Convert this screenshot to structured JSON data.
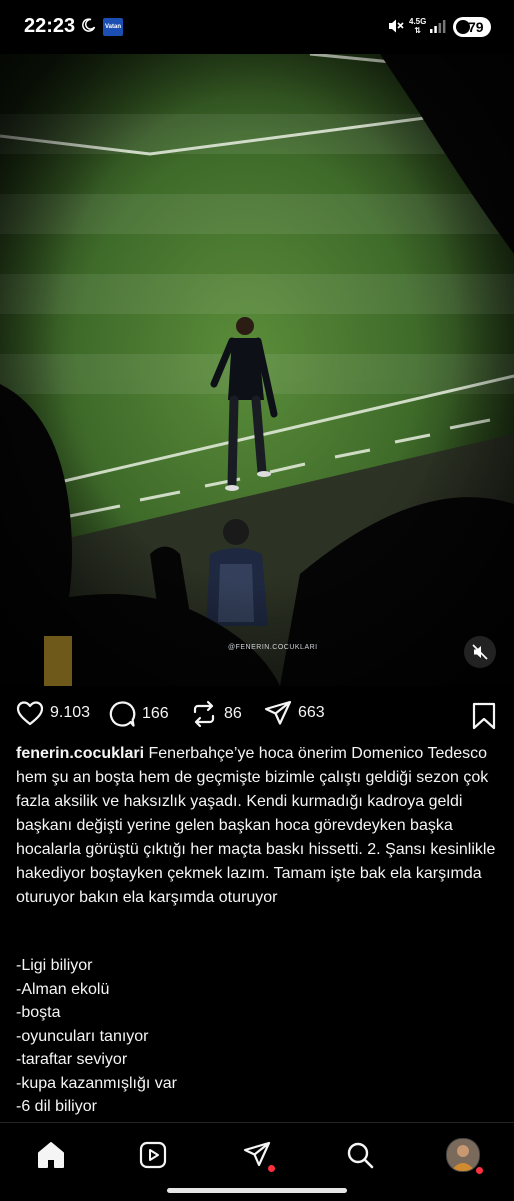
{
  "status_bar": {
    "time": "22:23",
    "network": "4.5G",
    "battery": "79"
  },
  "post": {
    "watermark": "@FENERIN.COCUKLARI",
    "likes": "9.103",
    "comments": "166",
    "reposts": "86",
    "shares": "663",
    "username": "fenerin.cocuklari",
    "caption": "Fenerbahçe’ye hoca önerim Domenico Tedesco hem şu an boşta hem de geçmişte bizimle çalıştı geldiği sezon çok fazla aksilik ve haksızlık yaşadı. Kendi kurmadığı kadroya geldi başkanı değişti yerine gelen başkan hoca görevdeyken başka hocalarla görüştü çıktığı her maçta baskı hissetti. 2. Şansı kesinlikle hakediyor boştayken çekmek lazım. Tamam işte bak ela karşımda oturuyor bakın ela karşımda oturuyor",
    "list": [
      "-Ligi biliyor",
      "-Alman ekolü",
      "-boşta",
      "-oyuncuları tanıyor",
      "-taraftar seviyor",
      "-kupa kazanmışlığı var",
      "-6 dil biliyor"
    ]
  },
  "colors": {
    "background": "#000000",
    "text": "#f5f5f5",
    "notification_dot": "#ff3040",
    "pitch": "#3f6b2a"
  },
  "icons": {
    "status": [
      "moon-icon",
      "vatan-app-icon",
      "mute-icon",
      "signal-icon",
      "battery-icon"
    ],
    "actions": [
      "heart-icon",
      "comment-icon",
      "repost-icon",
      "share-icon",
      "bookmark-icon"
    ],
    "nav": [
      "home-icon",
      "reels-icon",
      "messages-icon",
      "search-icon",
      "profile-avatar"
    ]
  }
}
